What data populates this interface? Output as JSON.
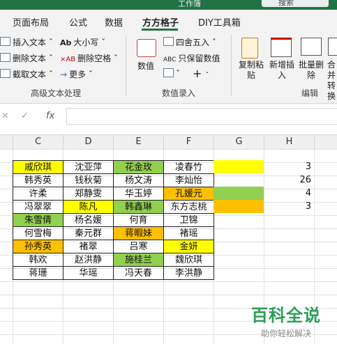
{
  "titlebar": {
    "title_fragment": "工作簿",
    "button_label": "搜索"
  },
  "tabs": [
    "页面布局",
    "公式",
    "数据",
    "方方格子",
    "DIY工具箱"
  ],
  "active_tab": "方方格子",
  "ribbon": {
    "text_group": {
      "items": [
        "插入文本 ˇ",
        "删除文本 ˇ",
        "截取文本 ˇ",
        "大小写 ˇ",
        "删除空格 ˇ",
        "更多 ˇ"
      ],
      "label": "高级文本处理"
    },
    "number_group": {
      "value_button": "数值",
      "items": [
        "四舍五入 ˇ",
        "只保留数值"
      ],
      "label": "数值录入"
    },
    "edit_group": {
      "buttons": [
        "复制粘贴",
        "新增插入",
        "批量删除",
        "合并转换"
      ],
      "label": "编辑"
    }
  },
  "formula_bar": {
    "cancel_icon": "×",
    "confirm_icon": "✓",
    "fx_label": "fx",
    "value": ""
  },
  "columns": [
    "C",
    "D",
    "E",
    "F",
    "G",
    "H"
  ],
  "name_grid": [
    [
      "戚欣琪",
      "沈亚萍",
      "花金玫",
      "凌春竹"
    ],
    [
      "韩秀英",
      "钱秋菊",
      "杨文涛",
      "李灿怡"
    ],
    [
      "许柔",
      "郑静雯",
      "华玉婷",
      "孔媛元"
    ],
    [
      "冯翠翠",
      "陈凡",
      "韩鑫琳",
      "东方志桃"
    ],
    [
      "朱雪倩",
      "杨名媛",
      "何育",
      "卫锦"
    ],
    [
      "何雪梅",
      "秦元群",
      "蒋暇妹",
      "褚瑶"
    ],
    [
      "孙秀英",
      "褚翠",
      "吕寒",
      "金妍"
    ],
    [
      "韩欢",
      "赵洪静",
      "施桂兰",
      "魏欣琪"
    ],
    [
      "蒋珊",
      "华瑶",
      "冯天春",
      "李洪静"
    ]
  ],
  "cell_fills": [
    [
      "yellow",
      "",
      "green",
      ""
    ],
    [
      "",
      "",
      "",
      ""
    ],
    [
      "",
      "",
      "",
      "orange"
    ],
    [
      "",
      "yellow",
      "green",
      ""
    ],
    [
      "green",
      "",
      "",
      ""
    ],
    [
      "",
      "",
      "orange",
      ""
    ],
    [
      "orange",
      "",
      "",
      "yellow"
    ],
    [
      "",
      "",
      "green",
      ""
    ],
    [
      "",
      "",
      "",
      ""
    ]
  ],
  "legend_fills": [
    "yellow",
    "",
    "green",
    "orange"
  ],
  "counts": [
    "3",
    "26",
    "4",
    "3"
  ],
  "colors": {
    "yellow": "#ffff00",
    "green": "#92d050",
    "orange": "#ffc000",
    "accent": "#217346"
  },
  "watermark": {
    "title": "百科全说",
    "subtitle": "助你轻松解决"
  }
}
